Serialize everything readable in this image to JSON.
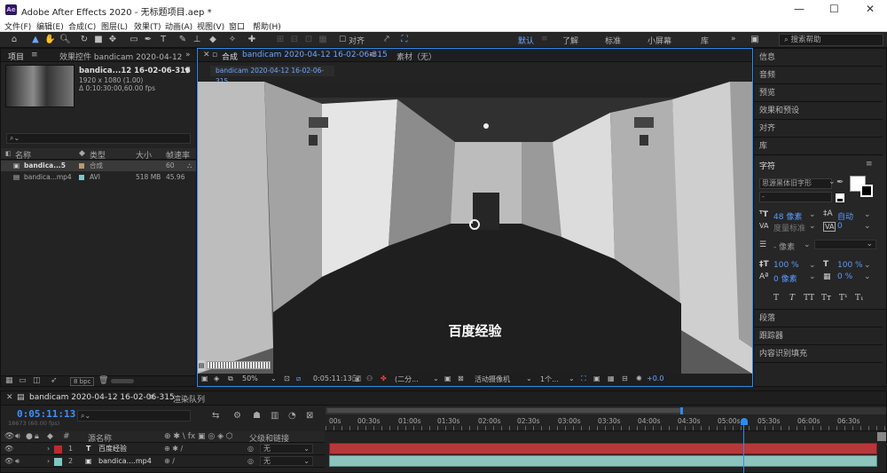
{
  "window": {
    "title": "Adobe After Effects 2020 - 无标题项目.aep *",
    "logo": "Ae",
    "minimize": "—",
    "maximize": "☐",
    "close": "✕"
  },
  "menu": [
    "文件(F)",
    "编辑(E)",
    "合成(C)",
    "图层(L)",
    "效果(T)",
    "动画(A)",
    "视图(V)",
    "窗口",
    "帮助(H)"
  ],
  "toolbar": {
    "align_label": "对齐",
    "workspaces": [
      "默认",
      "了解",
      "标准",
      "小屏幕",
      "库"
    ],
    "overflow": "»",
    "search_placeholder": "搜索帮助"
  },
  "project": {
    "tab_label": "项目",
    "effects_tab": "效果控件 bandicam 2020-04-12",
    "comp_name": "bandica...12 16-02-06-315",
    "comp_res": "1920 x 1080 (1.00)",
    "comp_duration": "Δ 0:10:30:00,60.00 fps",
    "columns": {
      "name": "名称",
      "type": "类型",
      "size": "大小",
      "fps": "帧速率"
    },
    "items": [
      {
        "name": "bandica...5",
        "type": "合成",
        "size": "",
        "fps": "60",
        "color": "#b59b6e"
      },
      {
        "name": "bandica...mp4",
        "type": "AVI",
        "size": "518 MB",
        "fps": "45.96",
        "color": "#7ec6c6"
      }
    ],
    "bpc": "8 bpc"
  },
  "composition": {
    "tab_label": "合成",
    "comp_tab_name": "bandicam 2020-04-12 16-02-06-315",
    "footage_tab": "素材（无）",
    "breadcrumb": "bandicam 2020-04-12 16-02-06-315",
    "overlay_text": "百度经验",
    "zoom": "50%",
    "timecode": "0:05:11:13",
    "resolution": "(二分...",
    "camera": "活动摄像机",
    "views": "1个...",
    "exposure": "+0.0"
  },
  "right_panel": {
    "items_top": [
      "信息",
      "音频",
      "预览",
      "效果和预设",
      "对齐",
      "库"
    ],
    "character": {
      "title": "字符",
      "font": "思源黑体旧字形",
      "style": "-",
      "size": "48 像素",
      "leading": "自动",
      "kerning": "度量标准",
      "tracking": "0",
      "stroke": "- 像素",
      "vscale": "100 %",
      "hscale": "100 %",
      "baseline": "0 像素",
      "tsume": "0 %",
      "styles": [
        "T",
        "T",
        "TT",
        "Tт",
        "T¹",
        "T₁"
      ]
    },
    "items_bottom": [
      "段落",
      "跟踪器",
      "内容识别填充"
    ]
  },
  "timeline": {
    "tab_label": "bandicam 2020-04-12 16-02-06-315",
    "render_tab": "渲染队列",
    "timecode": "0:05:11:13",
    "frame_info": "18673 (60.00 fps)",
    "columns": {
      "num": "#",
      "source": "源名称",
      "parent": "父级和链接"
    },
    "layers": [
      {
        "num": "1",
        "type_icon": "T",
        "name": "百度经验",
        "parent": "无",
        "color": "#c0292b"
      },
      {
        "num": "2",
        "type_icon": "▣",
        "name": "bandica....mp4",
        "parent": "无",
        "color": "#7ec6c6"
      }
    ],
    "ruler": [
      "00s",
      "00:30s",
      "01:00s",
      "01:30s",
      "02:00s",
      "02:30s",
      "03:00s",
      "03:30s",
      "04:00s",
      "04:30s",
      "05:00s",
      "05:30s",
      "06:00s",
      "06:30s"
    ]
  },
  "colors": {
    "accent": "#2d8ceb",
    "text_bar": "#b8373b",
    "video_bar": "#8cc4be"
  }
}
